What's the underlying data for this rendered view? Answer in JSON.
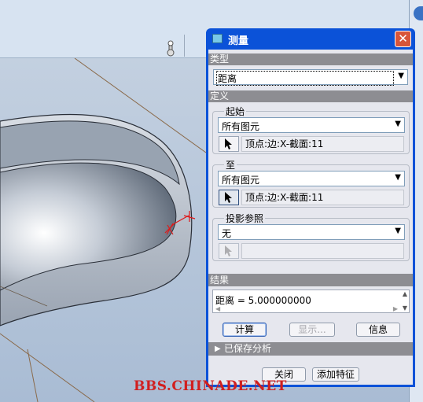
{
  "dialog": {
    "title": "测量",
    "close_glyph": "✕",
    "type_section": {
      "header": "类型",
      "selected": "距离"
    },
    "definition_section": {
      "header": "定义",
      "from": {
        "title": "起始",
        "filter": "所有图元",
        "selection": "顶点:边:X-截面:11"
      },
      "to": {
        "title": "至",
        "filter": "所有图元",
        "selection": "顶点:边:X-截面:11"
      },
      "projection": {
        "title": "投影参照",
        "filter": "无",
        "selection": ""
      }
    },
    "result_section": {
      "header": "结果",
      "text": "距离 = 5.000000000"
    },
    "buttons": {
      "compute": "计算",
      "show": "显示...",
      "info": "信息"
    },
    "saved_analysis": "已保存分析",
    "footer": {
      "close": "关闭",
      "add_feature": "添加特征"
    }
  },
  "watermark": "BBS.CHINADE.NET",
  "colors": {
    "titlebar": "#0b52d8",
    "section_header": "#8d8d92",
    "model_surface": "#b7c1cc",
    "selection_marker": "#e01818"
  },
  "icons": {
    "title": "dialog-app-icon",
    "picker": "arrow-cursor-icon",
    "dropdown": "chevron-down-icon",
    "expand": "triangle-right-icon"
  }
}
